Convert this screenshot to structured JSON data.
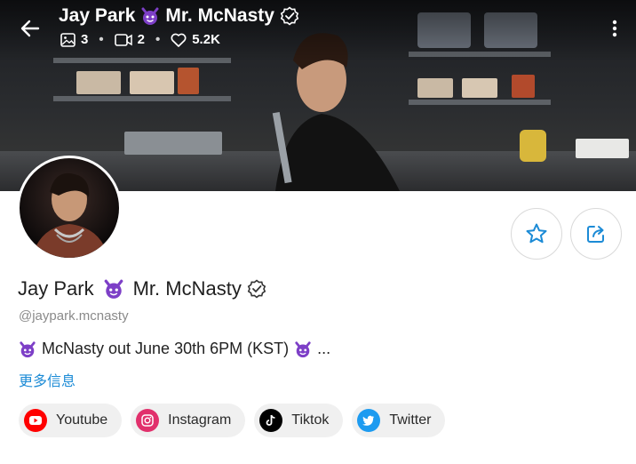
{
  "header": {
    "title_name": "Jay Park",
    "title_suffix": "Mr. McNasty",
    "stats": {
      "images": "3",
      "videos": "2",
      "likes": "5.2K"
    }
  },
  "profile": {
    "name": "Jay Park",
    "name_suffix": "Mr. McNasty",
    "handle": "@jaypark.mcnasty",
    "bio": "McNasty out June 30th 6PM (KST)",
    "bio_ellipsis": "...",
    "more_label": "更多信息"
  },
  "links": [
    {
      "label": "Youtube",
      "icon": "youtube-icon",
      "color": "#ff0000"
    },
    {
      "label": "Instagram",
      "icon": "instagram-icon",
      "color": "#e1306c"
    },
    {
      "label": "Tiktok",
      "icon": "tiktok-icon",
      "color": "#000000"
    },
    {
      "label": "Twitter",
      "icon": "twitter-icon",
      "color": "#1d9bf0"
    }
  ],
  "colors": {
    "accent": "#1c8bd6",
    "devil": "#7d3fc7"
  }
}
